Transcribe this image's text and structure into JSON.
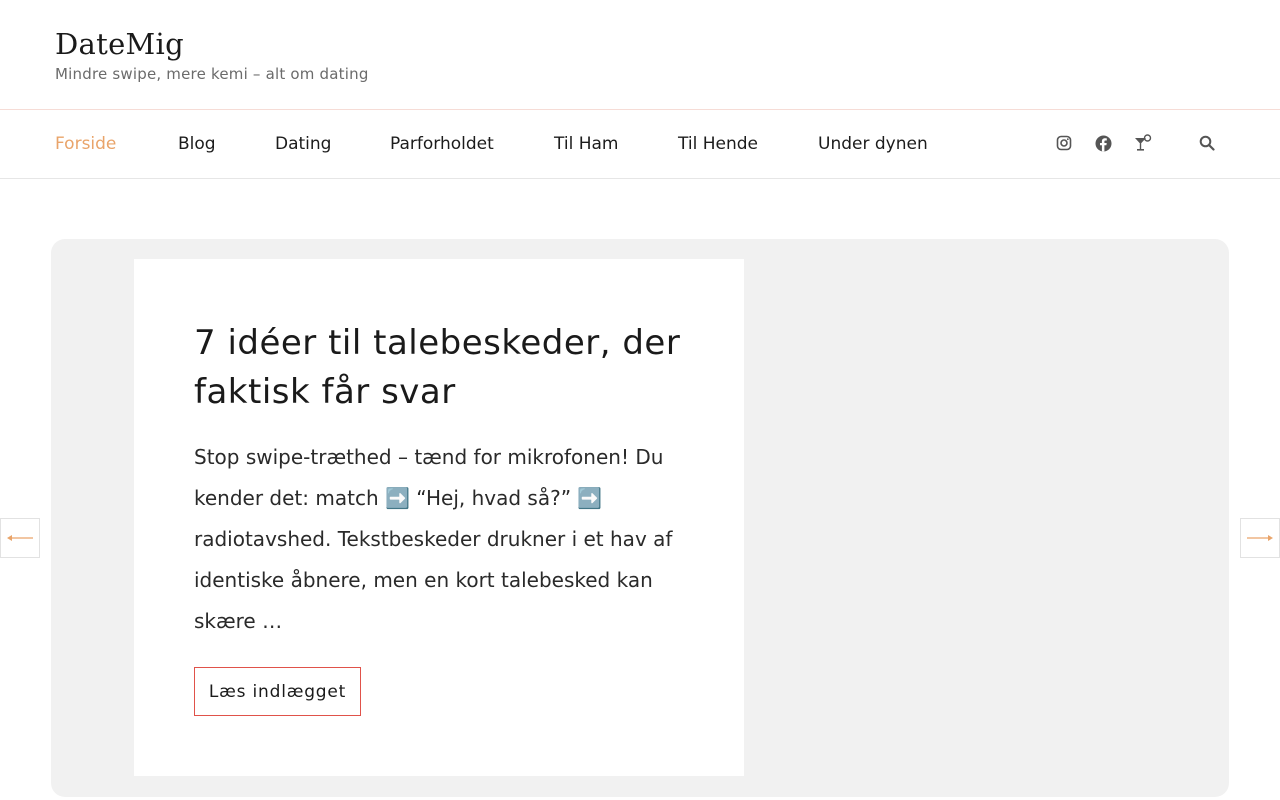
{
  "header": {
    "site_title": "DateMig",
    "tagline": "Mindre swipe, mere kemi – alt om dating"
  },
  "nav": {
    "items": [
      {
        "label": "Forside",
        "active": true
      },
      {
        "label": "Blog",
        "active": false
      },
      {
        "label": "Dating",
        "active": false
      },
      {
        "label": "Parforholdet",
        "active": false
      },
      {
        "label": "Til Ham",
        "active": false
      },
      {
        "label": "Til Hende",
        "active": false
      },
      {
        "label": "Under dynen",
        "active": false
      }
    ],
    "social_icons": [
      "instagram-icon",
      "facebook-icon",
      "cocktail-icon"
    ],
    "search_icon": "search-icon"
  },
  "post": {
    "title": "7 idéer til talebeskeder, der faktisk får svar",
    "excerpt": "Stop swipe-træthed – tænd for mikrofonen! Du kender det: match ➡️ “Hej, hvad så?” ➡️ radiotavshed. Tekstbeskeder drukner i et hav af identiske åbnere, men en kort talebesked kan skære …",
    "read_more_label": "Læs indlægget"
  },
  "slider": {
    "prev_icon": "arrow-left-icon",
    "next_icon": "arrow-right-icon"
  },
  "colors": {
    "accent": "#e9a46a",
    "button_border": "#e0524a",
    "slider_bg": "#f1f1f1",
    "header_border": "#f6dcd6"
  }
}
